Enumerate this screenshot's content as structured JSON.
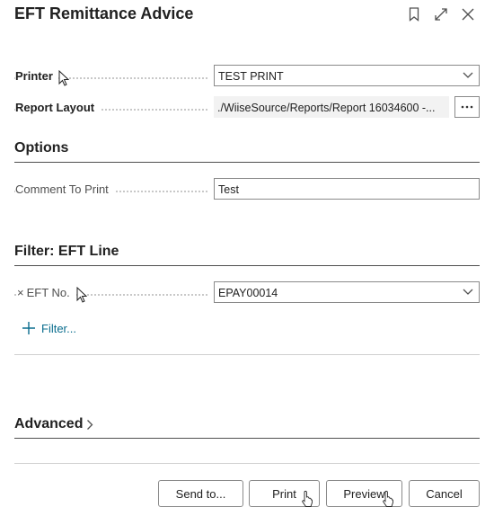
{
  "dialog": {
    "title": "EFT Remittance Advice"
  },
  "fields": {
    "printer": {
      "label": "Printer",
      "value": "TEST PRINT"
    },
    "report_layout": {
      "label": "Report Layout",
      "value": "./WiiseSource/Reports/Report 16034600 -..."
    }
  },
  "options": {
    "heading": "Options",
    "comment": {
      "label": "Comment To Print",
      "value": "Test"
    }
  },
  "filter": {
    "heading": "Filter: EFT Line",
    "remove_symbol": "×",
    "eft_no": {
      "label": "EFT No.",
      "value": "EPAY00014"
    },
    "add_label": "Filter..."
  },
  "advanced": {
    "heading": "Advanced"
  },
  "buttons": {
    "send_to": "Send to...",
    "print": "Print",
    "preview": "Preview",
    "cancel": "Cancel"
  }
}
